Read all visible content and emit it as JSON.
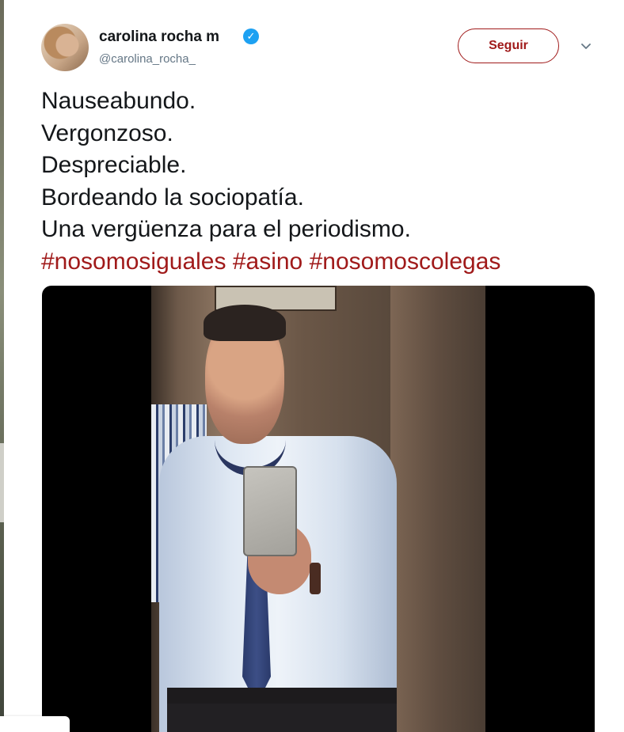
{
  "tweet": {
    "display_name": "carolina rocha m",
    "handle": "@carolina_rocha_",
    "follow_label": "Seguir",
    "lines": [
      "Nauseabundo.",
      "Vergonzoso.",
      "Despreciable.",
      "Bordeando la sociopatía.",
      "Una vergüenza para el periodismo."
    ],
    "hashtags": [
      "#nosomosiguales",
      "#asino",
      "#nosomoscolegas"
    ],
    "verified_icon": "check-badge",
    "more_icon": "chevron-down"
  },
  "colors": {
    "accent": "#a01a1a",
    "verified": "#1da1f2",
    "secondary_text": "#657786",
    "text": "#14171a"
  }
}
